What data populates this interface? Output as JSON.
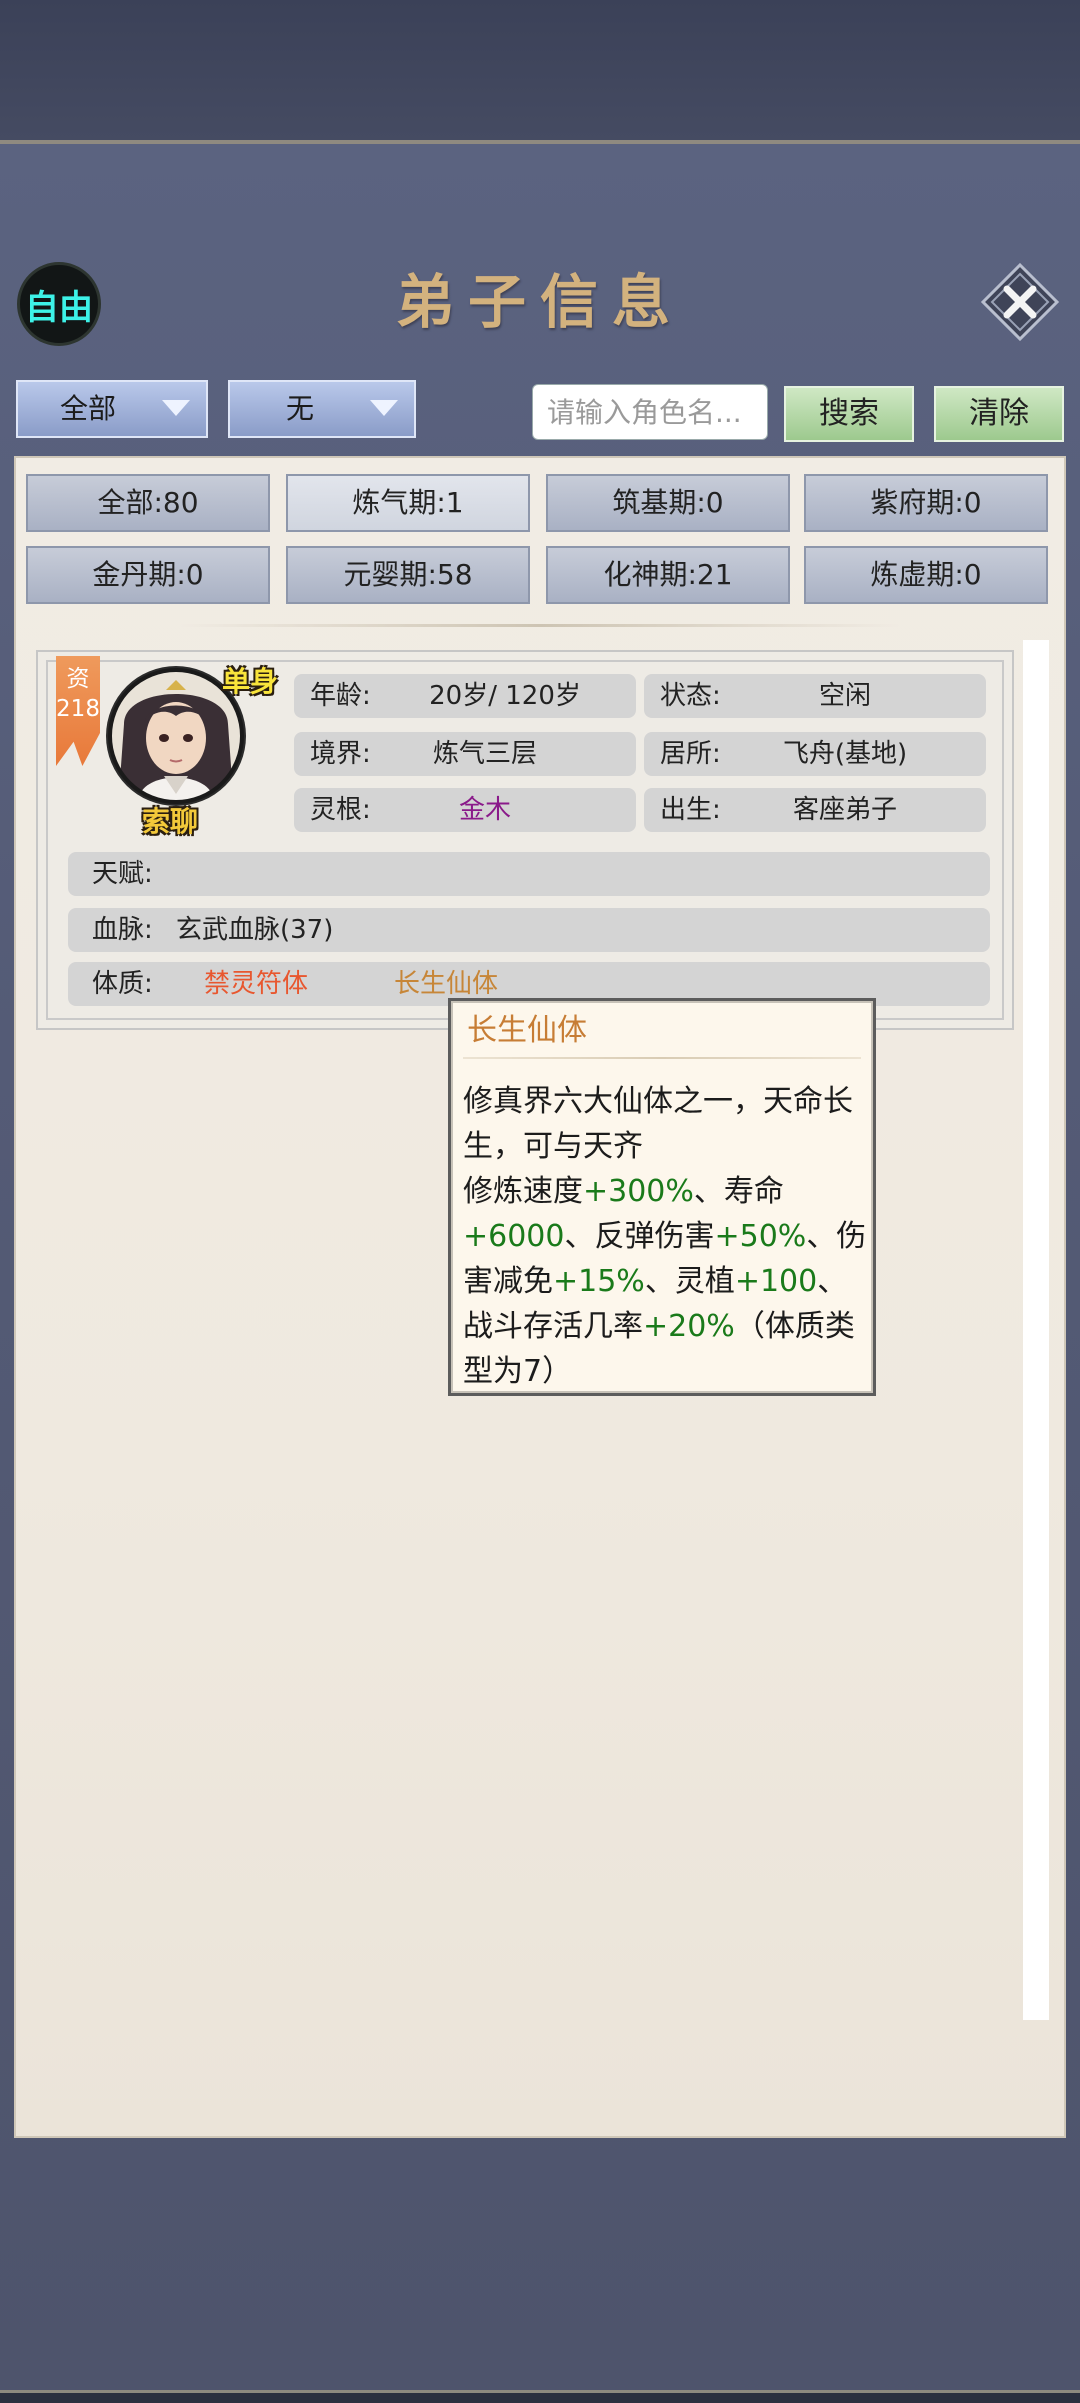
{
  "header": {
    "free_badge": "自由",
    "title": "弟子信息",
    "close_icon": "close-x-icon"
  },
  "filters": {
    "dropdown1": "全部",
    "dropdown2": "无",
    "search_placeholder": "请输入角色名...",
    "search_label": "搜索",
    "clear_label": "清除"
  },
  "realm_counts": [
    {
      "label": "全部:80",
      "selected": false
    },
    {
      "label": "炼气期:1",
      "selected": true
    },
    {
      "label": "筑基期:0",
      "selected": false
    },
    {
      "label": "紫府期:0",
      "selected": false
    },
    {
      "label": "金丹期:0",
      "selected": false
    },
    {
      "label": "元婴期:58",
      "selected": false
    },
    {
      "label": "化神期:21",
      "selected": false
    },
    {
      "label": "炼虚期:0",
      "selected": false
    }
  ],
  "disciple": {
    "grade_label": "资",
    "grade_value": "218",
    "name": "索聊",
    "marital_tag": "单身",
    "age_label": "年龄:",
    "age_value": "20岁/ 120岁",
    "status_label": "状态:",
    "status_value": "空闲",
    "realm_label": "境界:",
    "realm_value": "炼气三层",
    "residence_label": "居所:",
    "residence_value": "飞舟(基地)",
    "root_label": "灵根:",
    "root_value": "金木",
    "birth_label": "出生:",
    "birth_value": "客座弟子",
    "talent_label": "天赋:",
    "bloodline_label": "血脉:",
    "bloodline_value": "玄武血脉(37)",
    "physique_label": "体质:",
    "physique_1": "禁灵符体",
    "physique_2": "长生仙体"
  },
  "tooltip": {
    "title": "长生仙体",
    "line1": "修真界六大仙体之一，天命长生，可与天齐",
    "b1": "修炼速度",
    "g1": "+300%",
    "b2": "、寿命",
    "g2": "+6000",
    "b3": "、反弹伤害",
    "g3": "+50%",
    "b4": "、伤害减免",
    "g4": "+15%",
    "b5": "、灵植",
    "g5": "+100",
    "b6": "、战斗存活几率",
    "g6": "+20%",
    "b7": "（体质类型为7）"
  },
  "colors": {
    "root_value": "#8a1a8a",
    "physique_1": "#e8572f",
    "physique_2": "#c78638",
    "tooltip_green": "#1a7a1a",
    "title_gold": "#d3b27e",
    "free_cyan": "#3df2e8"
  }
}
